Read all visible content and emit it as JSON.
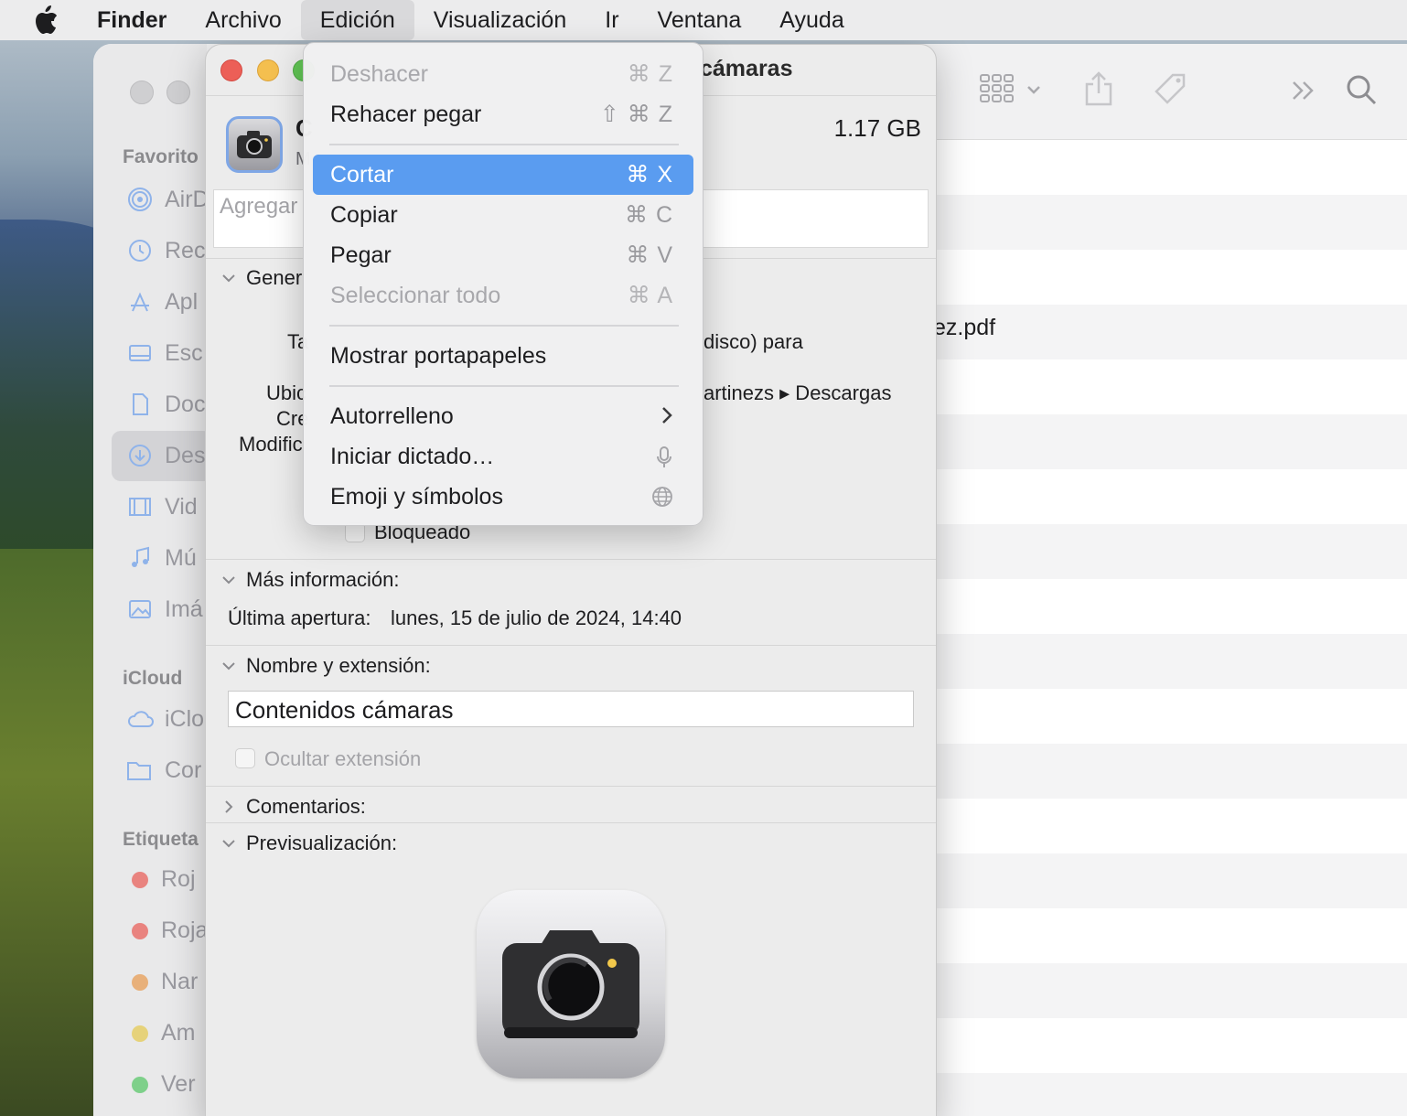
{
  "menubar": {
    "app_name": "Finder",
    "items": [
      "Archivo",
      "Edición",
      "Visualización",
      "Ir",
      "Ventana",
      "Ayuda"
    ],
    "active_item": "Edición"
  },
  "finder": {
    "sidebar_sections": {
      "favoritos": "Favorito",
      "icloud": "iCloud",
      "etiquetas": "Etiqueta"
    },
    "sidebar_items": [
      "AirD",
      "Rec",
      "Apl",
      "Esc",
      "Doc",
      "Des",
      "Vid",
      "Mú",
      "Imá"
    ],
    "icloud_items": [
      "iClo",
      "Cor"
    ],
    "tags": [
      {
        "label": "Roj",
        "color": "#e9837f"
      },
      {
        "label": "Roja",
        "color": "#e9837f"
      },
      {
        "label": "Nar",
        "color": "#e8b07a"
      },
      {
        "label": "Am",
        "color": "#e6d27a"
      },
      {
        "label": "Ver",
        "color": "#7ed08a"
      }
    ],
    "visible_file_fragment": "ez.pdf"
  },
  "info": {
    "title_fragment": "cámaras",
    "size": "1.17 GB",
    "name_initial": "C",
    "kind_initial": "M",
    "comment_placeholder": "Agregar",
    "general_label": "Gener",
    "kind_fragment": "Ta",
    "disk_fragment": "disco) para",
    "location_label": "Ubic",
    "location_value": "artinezs ▸ Descargas",
    "created_label": "Cre",
    "modified_label": "Modific",
    "locked_label": "Bloqueado",
    "more_info_label": "Más información:",
    "last_opened_label": "Última apertura:",
    "last_opened_value": "lunes, 15 de julio de 2024, 14:40",
    "name_ext_label": "Nombre y extensión:",
    "name_value": "Contenidos cámaras",
    "hide_ext_label": "Ocultar extensión",
    "comments_label": "Comentarios:",
    "preview_label": "Previsualización:"
  },
  "edit_menu": {
    "items": [
      {
        "label": "Deshacer",
        "shortcut": "⌘ Z",
        "disabled": true
      },
      {
        "label": "Rehacer pegar",
        "shortcut": "⇧ ⌘ Z",
        "disabled": false
      },
      {
        "label": "Cortar",
        "shortcut": "⌘ X",
        "disabled": false,
        "selected": true
      },
      {
        "label": "Copiar",
        "shortcut": "⌘ C",
        "disabled": false
      },
      {
        "label": "Pegar",
        "shortcut": "⌘ V",
        "disabled": false
      },
      {
        "label": "Seleccionar todo",
        "shortcut": "⌘ A",
        "disabled": true
      },
      {
        "label": "Mostrar portapapeles",
        "shortcut": "",
        "disabled": false
      },
      {
        "label": "Autorrelleno",
        "shortcut": "",
        "submenu": true
      },
      {
        "label": "Iniciar dictado…",
        "shortcut": "",
        "icon": "microphone-icon"
      },
      {
        "label": "Emoji y símbolos",
        "shortcut": "",
        "icon": "globe-icon"
      }
    ]
  },
  "colors": {
    "menu_highlight": "#5a9cf0",
    "close": "#ec5f57",
    "minimize": "#f4bf4f",
    "zoom": "#61c554"
  }
}
